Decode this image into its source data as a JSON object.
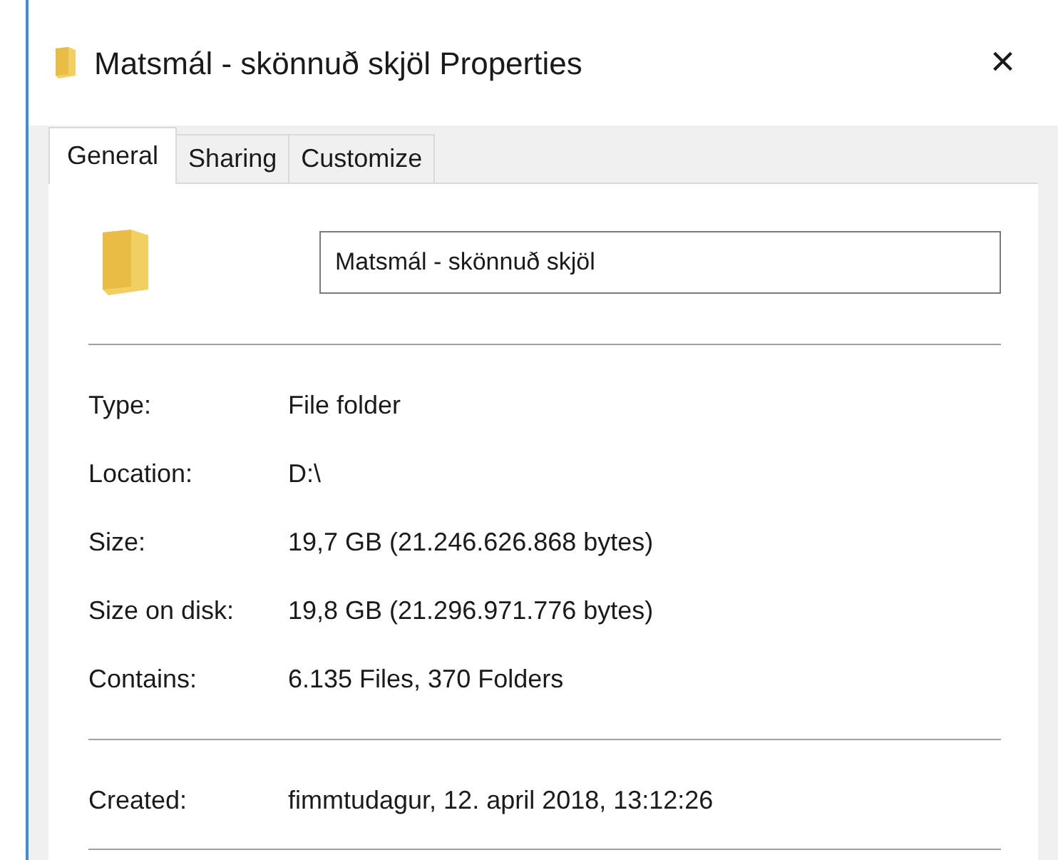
{
  "window": {
    "title": "Matsmál - skönnuð skjöl Properties",
    "close": "×"
  },
  "tabs": [
    {
      "label": "General",
      "selected": true
    },
    {
      "label": "Sharing",
      "selected": false
    },
    {
      "label": "Customize",
      "selected": false
    }
  ],
  "name_field": {
    "value": "Matsmál - skönnuð skjöl"
  },
  "sections": [
    {
      "rows": [
        {
          "label": "Type:",
          "value": "File folder"
        },
        {
          "label": "Location:",
          "value": "D:\\"
        },
        {
          "label": "Size:",
          "value": "19,7 GB (21.246.626.868 bytes)"
        },
        {
          "label": "Size on disk:",
          "value": "19,8 GB (21.296.971.776 bytes)"
        },
        {
          "label": "Contains:",
          "value": "6.135 Files, 370 Folders"
        }
      ]
    },
    {
      "rows": [
        {
          "label": "Created:",
          "value": "fimmtudagur, 12. april 2018, 13:12:26"
        }
      ]
    }
  ]
}
